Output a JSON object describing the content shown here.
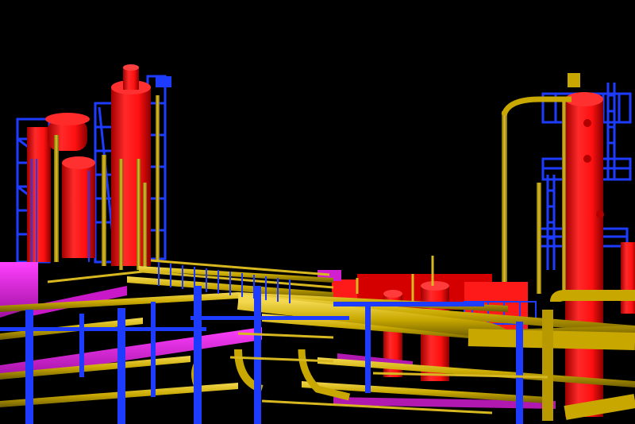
{
  "viewport": {
    "background": "#000000"
  },
  "palette": {
    "vessel": "#ff1a1a",
    "vessel_shade": "#b80000",
    "structure": "#1e3cff",
    "pipe": "#c8a800",
    "pipe_dark": "#8a7400",
    "pipe_light": "#f0d040",
    "duct": "#e020e0",
    "duct_dark": "#8a108a"
  },
  "objects": [
    {
      "name": "left-fractionation-column",
      "kind": "vessel"
    },
    {
      "name": "left-twin-column",
      "kind": "vessel"
    },
    {
      "name": "left-drum",
      "kind": "vessel"
    },
    {
      "name": "right-tall-column",
      "kind": "vessel"
    },
    {
      "name": "center-small-columns",
      "kind": "vessel"
    },
    {
      "name": "steel-structures",
      "kind": "structure"
    },
    {
      "name": "pipe-racks",
      "kind": "pipe"
    },
    {
      "name": "magenta-ducts",
      "kind": "duct"
    }
  ]
}
